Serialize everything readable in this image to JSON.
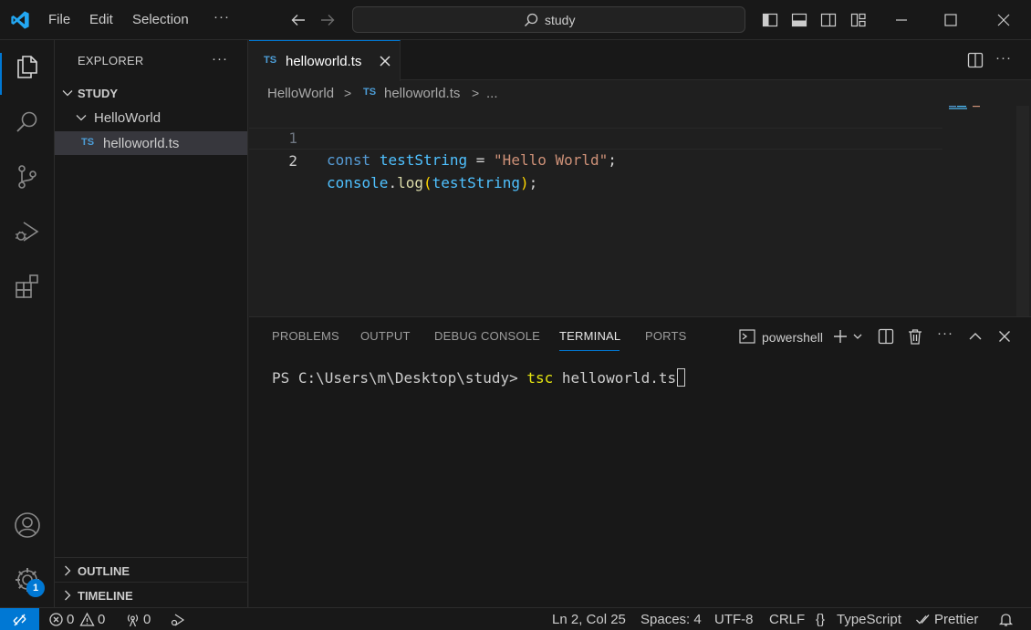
{
  "titlebar": {
    "menu": [
      "File",
      "Edit",
      "Selection"
    ],
    "more_label": "···",
    "command_center_text": "study"
  },
  "explorer": {
    "title": "EXPLORER",
    "more_label": "···",
    "tree": {
      "root": "STUDY",
      "folder": "HelloWorld",
      "file_badge": "TS",
      "file": "helloworld.ts"
    },
    "sections": [
      "OUTLINE",
      "TIMELINE"
    ]
  },
  "activity": {
    "settings_badge": "1"
  },
  "editor": {
    "tab": {
      "badge": "TS",
      "label": "helloworld.ts"
    },
    "more_label": "···",
    "breadcrumb": {
      "folder": "HelloWorld",
      "sep": ">",
      "file_badge": "TS",
      "file": "helloworld.ts",
      "ellipsis": "..."
    },
    "lines": [
      {
        "number": "1",
        "tokens": [
          "const",
          " ",
          "testString",
          " = ",
          "\"Hello World\"",
          ";"
        ]
      },
      {
        "number": "2",
        "tokens": [
          "console",
          ".",
          "log",
          "(",
          "testString",
          ")",
          ";"
        ]
      }
    ]
  },
  "panel": {
    "tabs": [
      "PROBLEMS",
      "OUTPUT",
      "DEBUG CONSOLE",
      "TERMINAL",
      "PORTS"
    ],
    "active_tab": "TERMINAL",
    "terminal_label": "powershell",
    "more_label": "···",
    "terminal": {
      "prompt": "PS C:\\Users\\m\\Desktop\\study> ",
      "command": "tsc",
      "args": " helloworld.ts"
    }
  },
  "statusbar": {
    "errors": "0",
    "warnings": "0",
    "ports": "0",
    "position": "Ln 2, Col 25",
    "spaces": "Spaces: 4",
    "encoding": "UTF-8",
    "eol": "CRLF",
    "language": "TypeScript",
    "formatter": "Prettier"
  },
  "colors": {
    "accent": "#0078d4",
    "keyword": "#569cd6",
    "variable": "#4fc1ff",
    "function": "#dcdcaa",
    "string": "#ce9178",
    "ts_badge": "#4d9ed8"
  }
}
